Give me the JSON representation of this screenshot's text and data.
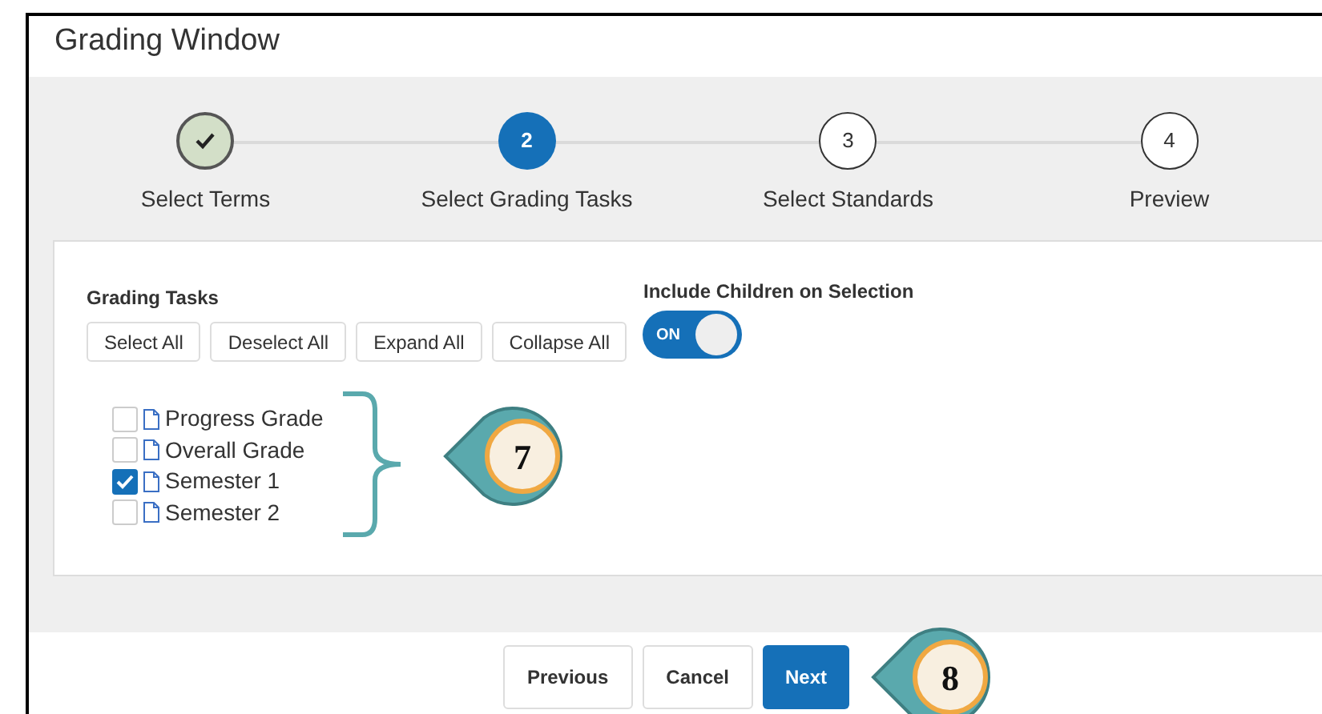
{
  "window": {
    "title": "Grading Window"
  },
  "steps": [
    {
      "label": "Select Terms",
      "kind": "done"
    },
    {
      "label": "Select Grading Tasks",
      "number": "2",
      "kind": "current"
    },
    {
      "label": "Select Standards",
      "number": "3",
      "kind": "upcoming"
    },
    {
      "label": "Preview",
      "number": "4",
      "kind": "upcoming"
    }
  ],
  "grading_tasks": {
    "heading": "Grading Tasks",
    "buttons": [
      "Select All",
      "Deselect All",
      "Expand All",
      "Collapse All"
    ],
    "include_children": {
      "label": "Include Children on Selection",
      "on": true,
      "state_text": "ON"
    },
    "items": [
      {
        "label": "Progress Grade",
        "checked": false
      },
      {
        "label": "Overall Grade",
        "checked": false
      },
      {
        "label": "Semester 1",
        "checked": true
      },
      {
        "label": "Semester 2",
        "checked": false
      }
    ]
  },
  "footer_buttons": [
    {
      "label": "Previous",
      "kind": "secondary"
    },
    {
      "label": "Cancel",
      "kind": "secondary"
    },
    {
      "label": "Next",
      "kind": "primary"
    }
  ],
  "callouts": [
    {
      "number": "7"
    },
    {
      "number": "8"
    }
  ]
}
